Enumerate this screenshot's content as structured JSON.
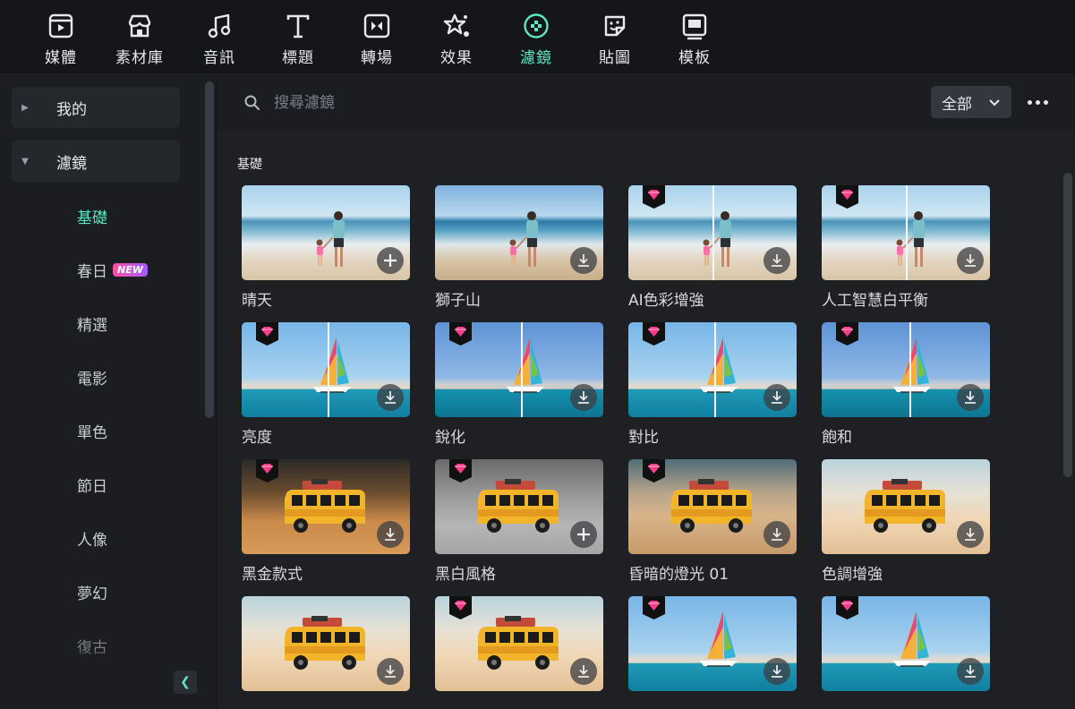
{
  "tabs": [
    {
      "label": "媒體",
      "icon": "media-icon"
    },
    {
      "label": "素材庫",
      "icon": "store-icon"
    },
    {
      "label": "音訊",
      "icon": "music-note-icon"
    },
    {
      "label": "標題",
      "icon": "title-text-icon"
    },
    {
      "label": "轉場",
      "icon": "transition-icon"
    },
    {
      "label": "效果",
      "icon": "effects-icon"
    },
    {
      "label": "濾鏡",
      "icon": "filter-icon"
    },
    {
      "label": "貼圖",
      "icon": "sticker-icon"
    },
    {
      "label": "模板",
      "icon": "template-icon"
    }
  ],
  "sidebar": {
    "groups": [
      {
        "label": "我的",
        "expanded": false
      },
      {
        "label": "濾鏡",
        "expanded": true
      }
    ],
    "items": [
      "基礎",
      "春日",
      "精選",
      "電影",
      "單色",
      "節日",
      "人像",
      "夢幻",
      "復古"
    ],
    "new_badge": "NEW"
  },
  "search": {
    "placeholder": "搜尋濾鏡"
  },
  "filter_dropdown": {
    "value": "全部"
  },
  "section": {
    "title": "基礎"
  },
  "cards": [
    {
      "label": "晴天",
      "premium": false,
      "action": "add"
    },
    {
      "label": "獅子山",
      "premium": false,
      "action": "download"
    },
    {
      "label": "AI色彩增強",
      "premium": true,
      "action": "download"
    },
    {
      "label": "人工智慧白平衡",
      "premium": true,
      "action": "download"
    },
    {
      "label": "亮度",
      "premium": true,
      "action": "download"
    },
    {
      "label": "銳化",
      "premium": true,
      "action": "download"
    },
    {
      "label": "對比",
      "premium": true,
      "action": "download"
    },
    {
      "label": "飽和",
      "premium": true,
      "action": "download"
    },
    {
      "label": "黑金款式",
      "premium": true,
      "action": "download"
    },
    {
      "label": "黑白風格",
      "premium": true,
      "action": "add"
    },
    {
      "label": "昏暗的燈光 01",
      "premium": true,
      "action": "download"
    },
    {
      "label": "色調增強",
      "premium": false,
      "action": "download"
    },
    {
      "label": "",
      "premium": false,
      "action": "download"
    },
    {
      "label": "",
      "premium": true,
      "action": "download"
    },
    {
      "label": "",
      "premium": true,
      "action": "download"
    },
    {
      "label": "",
      "premium": true,
      "action": "download"
    }
  ],
  "colors": {
    "accent": "#5fe6c4",
    "premium_badge": "#ff3d8a",
    "background": "#1e2024"
  }
}
